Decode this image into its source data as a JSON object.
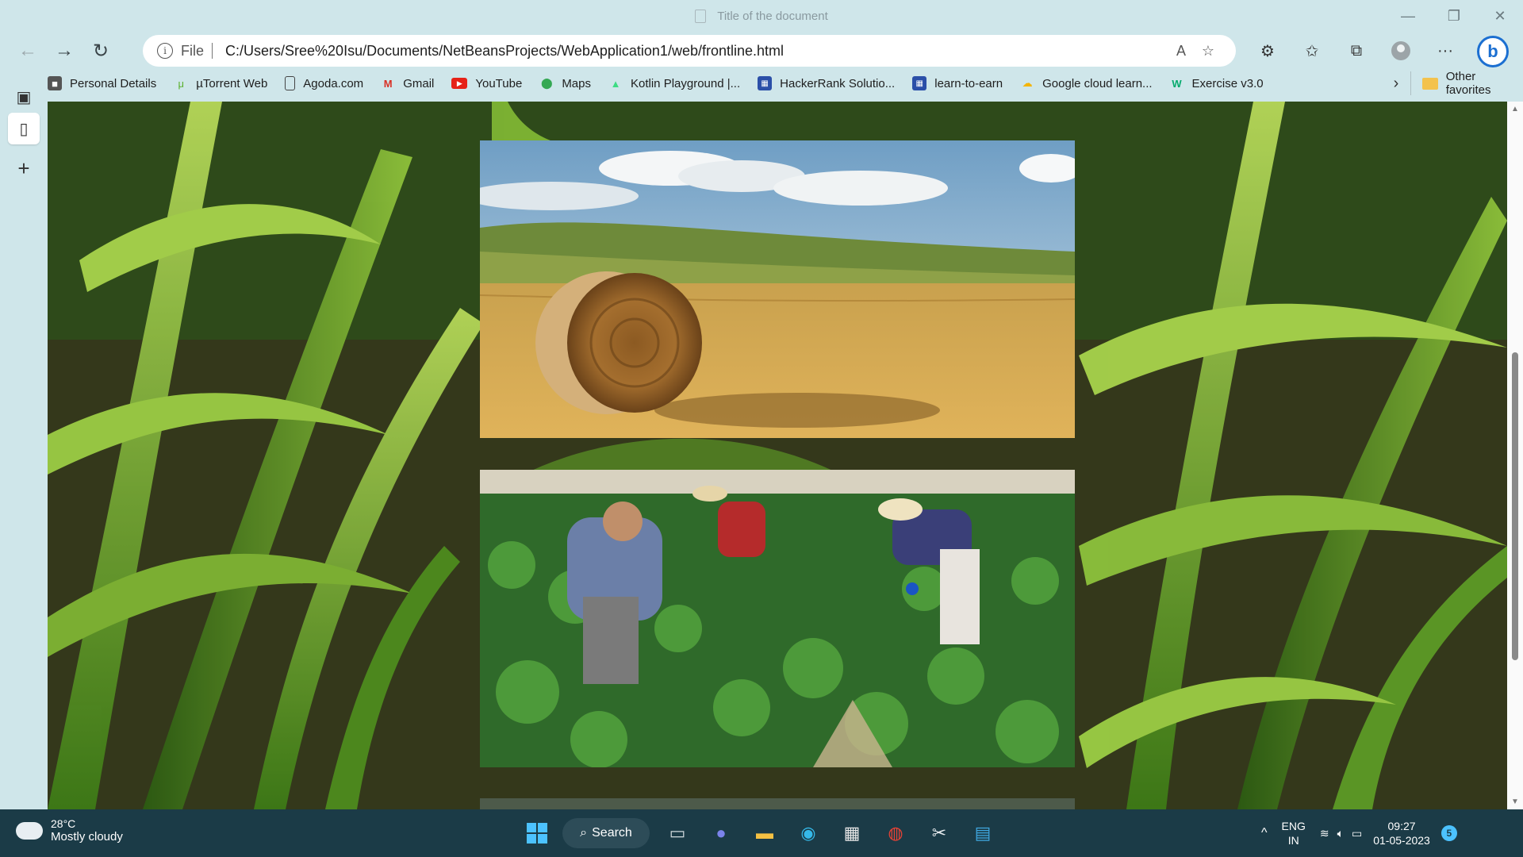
{
  "window": {
    "title": "Title of the document",
    "controls": [
      "minimize",
      "restore",
      "close"
    ]
  },
  "navbar": {
    "file_label": "File",
    "url": "C:/Users/Sree%20Isu/Documents/NetBeansProjects/WebApplication1/web/frontline.html"
  },
  "favorites": {
    "items": [
      {
        "label": "Personal Details",
        "icon": "profile-icon"
      },
      {
        "label": "µTorrent Web",
        "icon": "utorrent-icon"
      },
      {
        "label": "Agoda.com",
        "icon": "page-icon"
      },
      {
        "label": "Gmail",
        "icon": "gmail-icon"
      },
      {
        "label": "YouTube",
        "icon": "youtube-icon"
      },
      {
        "label": "Maps",
        "icon": "maps-pin-icon"
      },
      {
        "label": "Kotlin Playground |...",
        "icon": "android-icon"
      },
      {
        "label": "HackerRank Solutio...",
        "icon": "site-icon"
      },
      {
        "label": "learn-to-earn",
        "icon": "site-icon"
      },
      {
        "label": "Google cloud learn...",
        "icon": "google-cloud-icon"
      },
      {
        "label": "Exercise v3.0",
        "icon": "w3-icon"
      }
    ],
    "other": "Other favorites"
  },
  "page": {
    "photos": [
      {
        "name": "hay-bale-field",
        "alt": ""
      },
      {
        "name": "farmers-cabbage-field",
        "alt": ""
      }
    ]
  },
  "taskbar": {
    "weather_temp": "28°C",
    "weather_desc": "Mostly cloudy",
    "search_label": "Search",
    "lang_top": "ENG",
    "lang_bottom": "IN",
    "time": "09:27",
    "date": "01-05-2023",
    "notification_count": "5"
  }
}
